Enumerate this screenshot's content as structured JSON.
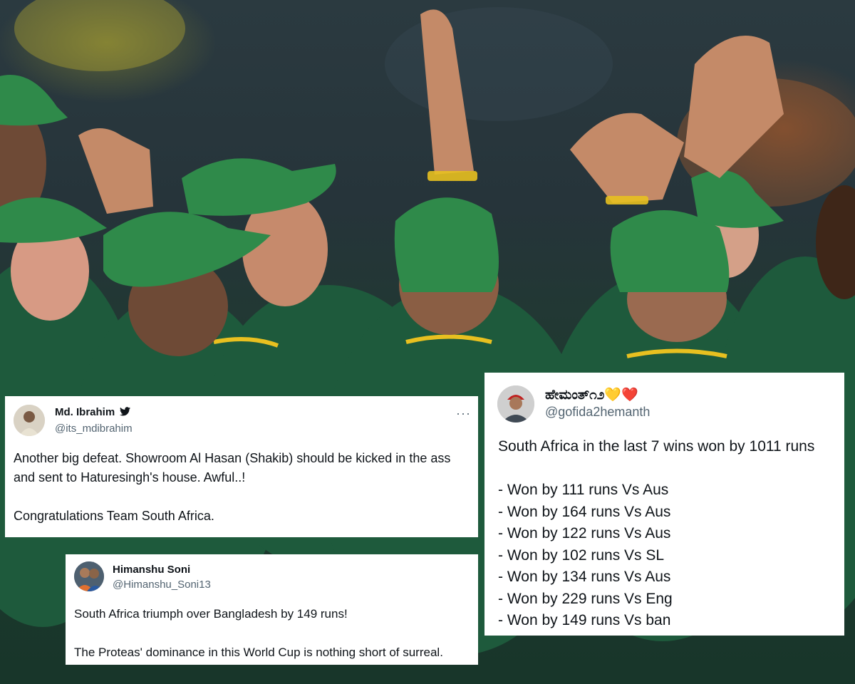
{
  "tweets": [
    {
      "name": "Md. Ibrahim",
      "verified_icon": "bird-icon",
      "handle": "@its_mdibrahim",
      "more_label": "···",
      "text": "Another big defeat. Showroom Al Hasan (Shakib) should be kicked in the ass and sent to Haturesingh's house. Awful..!\n\nCongratulations Team South Africa."
    },
    {
      "name": "Himanshu Soni",
      "handle": "@Himanshu_Soni13",
      "text": "South Africa triumph over Bangladesh by 149 runs!\n\nThe Proteas' dominance in this World Cup is nothing short of surreal."
    },
    {
      "name": "ಹೇಮಂತ್೧೨💛❤️",
      "handle": "@gofida2hemanth",
      "text": "South Africa in the last 7 wins won by 1011 runs\n\n- Won by 111 runs Vs Aus\n- Won by 164 runs Vs Aus\n- Won by 122 runs Vs Aus\n- Won by 102 runs Vs SL\n- Won by 134 runs Vs Aus\n- Won by 229 runs Vs Eng\n- Won by 149 runs Vs ban"
    }
  ],
  "colors": {
    "jersey_green": "#1f5a3a",
    "cap_green": "#2f8a4a",
    "trim_yellow": "#e8c020"
  }
}
